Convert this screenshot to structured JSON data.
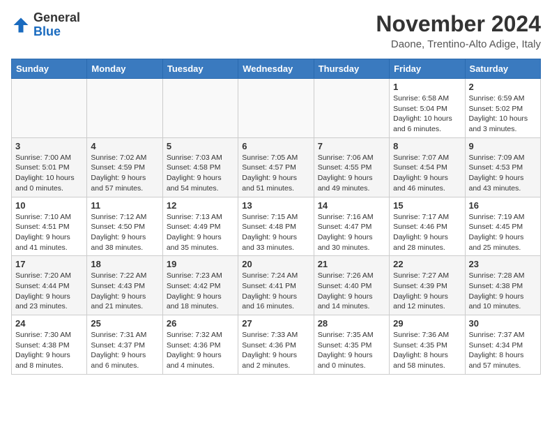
{
  "header": {
    "logo_line1": "General",
    "logo_line2": "Blue",
    "month": "November 2024",
    "location": "Daone, Trentino-Alto Adige, Italy"
  },
  "days_of_week": [
    "Sunday",
    "Monday",
    "Tuesday",
    "Wednesday",
    "Thursday",
    "Friday",
    "Saturday"
  ],
  "weeks": [
    [
      {
        "day": "",
        "info": ""
      },
      {
        "day": "",
        "info": ""
      },
      {
        "day": "",
        "info": ""
      },
      {
        "day": "",
        "info": ""
      },
      {
        "day": "",
        "info": ""
      },
      {
        "day": "1",
        "info": "Sunrise: 6:58 AM\nSunset: 5:04 PM\nDaylight: 10 hours\nand 6 minutes."
      },
      {
        "day": "2",
        "info": "Sunrise: 6:59 AM\nSunset: 5:02 PM\nDaylight: 10 hours\nand 3 minutes."
      }
    ],
    [
      {
        "day": "3",
        "info": "Sunrise: 7:00 AM\nSunset: 5:01 PM\nDaylight: 10 hours\nand 0 minutes."
      },
      {
        "day": "4",
        "info": "Sunrise: 7:02 AM\nSunset: 4:59 PM\nDaylight: 9 hours\nand 57 minutes."
      },
      {
        "day": "5",
        "info": "Sunrise: 7:03 AM\nSunset: 4:58 PM\nDaylight: 9 hours\nand 54 minutes."
      },
      {
        "day": "6",
        "info": "Sunrise: 7:05 AM\nSunset: 4:57 PM\nDaylight: 9 hours\nand 51 minutes."
      },
      {
        "day": "7",
        "info": "Sunrise: 7:06 AM\nSunset: 4:55 PM\nDaylight: 9 hours\nand 49 minutes."
      },
      {
        "day": "8",
        "info": "Sunrise: 7:07 AM\nSunset: 4:54 PM\nDaylight: 9 hours\nand 46 minutes."
      },
      {
        "day": "9",
        "info": "Sunrise: 7:09 AM\nSunset: 4:53 PM\nDaylight: 9 hours\nand 43 minutes."
      }
    ],
    [
      {
        "day": "10",
        "info": "Sunrise: 7:10 AM\nSunset: 4:51 PM\nDaylight: 9 hours\nand 41 minutes."
      },
      {
        "day": "11",
        "info": "Sunrise: 7:12 AM\nSunset: 4:50 PM\nDaylight: 9 hours\nand 38 minutes."
      },
      {
        "day": "12",
        "info": "Sunrise: 7:13 AM\nSunset: 4:49 PM\nDaylight: 9 hours\nand 35 minutes."
      },
      {
        "day": "13",
        "info": "Sunrise: 7:15 AM\nSunset: 4:48 PM\nDaylight: 9 hours\nand 33 minutes."
      },
      {
        "day": "14",
        "info": "Sunrise: 7:16 AM\nSunset: 4:47 PM\nDaylight: 9 hours\nand 30 minutes."
      },
      {
        "day": "15",
        "info": "Sunrise: 7:17 AM\nSunset: 4:46 PM\nDaylight: 9 hours\nand 28 minutes."
      },
      {
        "day": "16",
        "info": "Sunrise: 7:19 AM\nSunset: 4:45 PM\nDaylight: 9 hours\nand 25 minutes."
      }
    ],
    [
      {
        "day": "17",
        "info": "Sunrise: 7:20 AM\nSunset: 4:44 PM\nDaylight: 9 hours\nand 23 minutes."
      },
      {
        "day": "18",
        "info": "Sunrise: 7:22 AM\nSunset: 4:43 PM\nDaylight: 9 hours\nand 21 minutes."
      },
      {
        "day": "19",
        "info": "Sunrise: 7:23 AM\nSunset: 4:42 PM\nDaylight: 9 hours\nand 18 minutes."
      },
      {
        "day": "20",
        "info": "Sunrise: 7:24 AM\nSunset: 4:41 PM\nDaylight: 9 hours\nand 16 minutes."
      },
      {
        "day": "21",
        "info": "Sunrise: 7:26 AM\nSunset: 4:40 PM\nDaylight: 9 hours\nand 14 minutes."
      },
      {
        "day": "22",
        "info": "Sunrise: 7:27 AM\nSunset: 4:39 PM\nDaylight: 9 hours\nand 12 minutes."
      },
      {
        "day": "23",
        "info": "Sunrise: 7:28 AM\nSunset: 4:38 PM\nDaylight: 9 hours\nand 10 minutes."
      }
    ],
    [
      {
        "day": "24",
        "info": "Sunrise: 7:30 AM\nSunset: 4:38 PM\nDaylight: 9 hours\nand 8 minutes."
      },
      {
        "day": "25",
        "info": "Sunrise: 7:31 AM\nSunset: 4:37 PM\nDaylight: 9 hours\nand 6 minutes."
      },
      {
        "day": "26",
        "info": "Sunrise: 7:32 AM\nSunset: 4:36 PM\nDaylight: 9 hours\nand 4 minutes."
      },
      {
        "day": "27",
        "info": "Sunrise: 7:33 AM\nSunset: 4:36 PM\nDaylight: 9 hours\nand 2 minutes."
      },
      {
        "day": "28",
        "info": "Sunrise: 7:35 AM\nSunset: 4:35 PM\nDaylight: 9 hours\nand 0 minutes."
      },
      {
        "day": "29",
        "info": "Sunrise: 7:36 AM\nSunset: 4:35 PM\nDaylight: 8 hours\nand 58 minutes."
      },
      {
        "day": "30",
        "info": "Sunrise: 7:37 AM\nSunset: 4:34 PM\nDaylight: 8 hours\nand 57 minutes."
      }
    ]
  ]
}
